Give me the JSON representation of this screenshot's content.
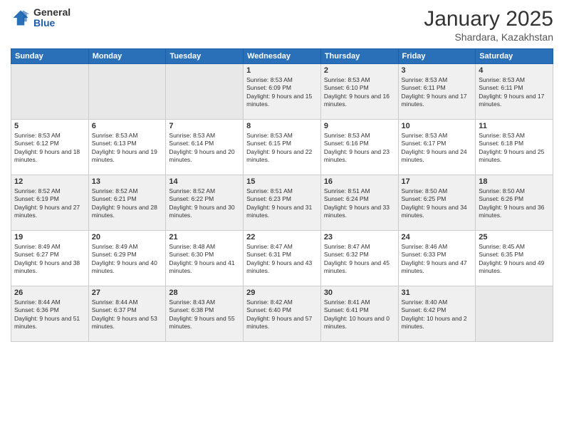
{
  "logo": {
    "general": "General",
    "blue": "Blue"
  },
  "header": {
    "month": "January 2025",
    "location": "Shardara, Kazakhstan"
  },
  "weekdays": [
    "Sunday",
    "Monday",
    "Tuesday",
    "Wednesday",
    "Thursday",
    "Friday",
    "Saturday"
  ],
  "weeks": [
    [
      {
        "day": "",
        "empty": true
      },
      {
        "day": "",
        "empty": true
      },
      {
        "day": "",
        "empty": true
      },
      {
        "day": "1",
        "sunrise": "8:53 AM",
        "sunset": "6:09 PM",
        "daylight": "9 hours and 15 minutes."
      },
      {
        "day": "2",
        "sunrise": "8:53 AM",
        "sunset": "6:10 PM",
        "daylight": "9 hours and 16 minutes."
      },
      {
        "day": "3",
        "sunrise": "8:53 AM",
        "sunset": "6:11 PM",
        "daylight": "9 hours and 17 minutes."
      },
      {
        "day": "4",
        "sunrise": "8:53 AM",
        "sunset": "6:11 PM",
        "daylight": "9 hours and 17 minutes."
      }
    ],
    [
      {
        "day": "5",
        "sunrise": "8:53 AM",
        "sunset": "6:12 PM",
        "daylight": "9 hours and 18 minutes."
      },
      {
        "day": "6",
        "sunrise": "8:53 AM",
        "sunset": "6:13 PM",
        "daylight": "9 hours and 19 minutes."
      },
      {
        "day": "7",
        "sunrise": "8:53 AM",
        "sunset": "6:14 PM",
        "daylight": "9 hours and 20 minutes."
      },
      {
        "day": "8",
        "sunrise": "8:53 AM",
        "sunset": "6:15 PM",
        "daylight": "9 hours and 22 minutes."
      },
      {
        "day": "9",
        "sunrise": "8:53 AM",
        "sunset": "6:16 PM",
        "daylight": "9 hours and 23 minutes."
      },
      {
        "day": "10",
        "sunrise": "8:53 AM",
        "sunset": "6:17 PM",
        "daylight": "9 hours and 24 minutes."
      },
      {
        "day": "11",
        "sunrise": "8:53 AM",
        "sunset": "6:18 PM",
        "daylight": "9 hours and 25 minutes."
      }
    ],
    [
      {
        "day": "12",
        "sunrise": "8:52 AM",
        "sunset": "6:19 PM",
        "daylight": "9 hours and 27 minutes."
      },
      {
        "day": "13",
        "sunrise": "8:52 AM",
        "sunset": "6:21 PM",
        "daylight": "9 hours and 28 minutes."
      },
      {
        "day": "14",
        "sunrise": "8:52 AM",
        "sunset": "6:22 PM",
        "daylight": "9 hours and 30 minutes."
      },
      {
        "day": "15",
        "sunrise": "8:51 AM",
        "sunset": "6:23 PM",
        "daylight": "9 hours and 31 minutes."
      },
      {
        "day": "16",
        "sunrise": "8:51 AM",
        "sunset": "6:24 PM",
        "daylight": "9 hours and 33 minutes."
      },
      {
        "day": "17",
        "sunrise": "8:50 AM",
        "sunset": "6:25 PM",
        "daylight": "9 hours and 34 minutes."
      },
      {
        "day": "18",
        "sunrise": "8:50 AM",
        "sunset": "6:26 PM",
        "daylight": "9 hours and 36 minutes."
      }
    ],
    [
      {
        "day": "19",
        "sunrise": "8:49 AM",
        "sunset": "6:27 PM",
        "daylight": "9 hours and 38 minutes."
      },
      {
        "day": "20",
        "sunrise": "8:49 AM",
        "sunset": "6:29 PM",
        "daylight": "9 hours and 40 minutes."
      },
      {
        "day": "21",
        "sunrise": "8:48 AM",
        "sunset": "6:30 PM",
        "daylight": "9 hours and 41 minutes."
      },
      {
        "day": "22",
        "sunrise": "8:47 AM",
        "sunset": "6:31 PM",
        "daylight": "9 hours and 43 minutes."
      },
      {
        "day": "23",
        "sunrise": "8:47 AM",
        "sunset": "6:32 PM",
        "daylight": "9 hours and 45 minutes."
      },
      {
        "day": "24",
        "sunrise": "8:46 AM",
        "sunset": "6:33 PM",
        "daylight": "9 hours and 47 minutes."
      },
      {
        "day": "25",
        "sunrise": "8:45 AM",
        "sunset": "6:35 PM",
        "daylight": "9 hours and 49 minutes."
      }
    ],
    [
      {
        "day": "26",
        "sunrise": "8:44 AM",
        "sunset": "6:36 PM",
        "daylight": "9 hours and 51 minutes."
      },
      {
        "day": "27",
        "sunrise": "8:44 AM",
        "sunset": "6:37 PM",
        "daylight": "9 hours and 53 minutes."
      },
      {
        "day": "28",
        "sunrise": "8:43 AM",
        "sunset": "6:38 PM",
        "daylight": "9 hours and 55 minutes."
      },
      {
        "day": "29",
        "sunrise": "8:42 AM",
        "sunset": "6:40 PM",
        "daylight": "9 hours and 57 minutes."
      },
      {
        "day": "30",
        "sunrise": "8:41 AM",
        "sunset": "6:41 PM",
        "daylight": "10 hours and 0 minutes."
      },
      {
        "day": "31",
        "sunrise": "8:40 AM",
        "sunset": "6:42 PM",
        "daylight": "10 hours and 2 minutes."
      },
      {
        "day": "",
        "empty": true
      }
    ]
  ]
}
